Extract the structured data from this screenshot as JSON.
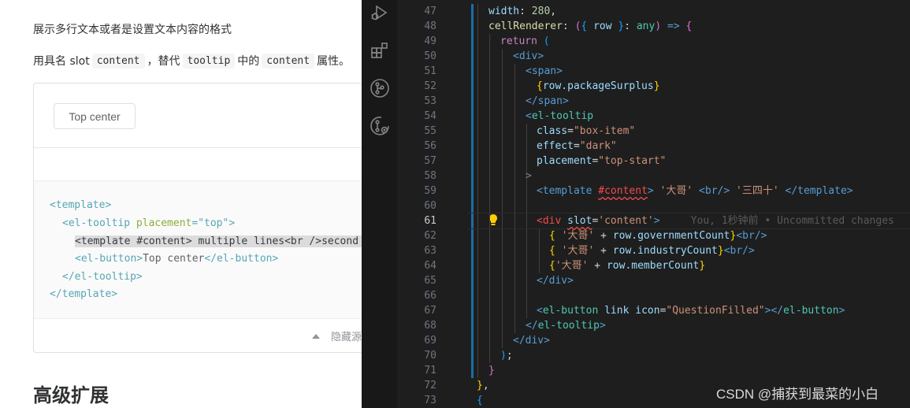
{
  "doc": {
    "paragraph1": "展示多行文本或者是设置文本内容的格式",
    "paragraph2": {
      "part1": "用具名 slot ",
      "code1": "content",
      "part2": "，替代 ",
      "code2": "tooltip",
      "part3": " 中的 ",
      "code3": "content",
      "part4": " 属性。"
    },
    "demo_button_label": "Top center",
    "code_lines": [
      [
        "<template>"
      ],
      [
        "<el-tooltip ",
        "placement",
        "=\"top\">"
      ],
      [
        "<template #content> multiple lines<br />second l"
      ],
      [
        "<el-button>",
        "Top center",
        "</el-button>"
      ],
      [
        "</el-tooltip>"
      ],
      [
        "</template>"
      ]
    ],
    "hide_source_label": "隐藏源",
    "section_heading": "高级扩展"
  },
  "editor": {
    "line_numbers": [
      "47",
      "48",
      "49",
      "50",
      "51",
      "52",
      "53",
      "54",
      "55",
      "56",
      "57",
      "58",
      "59",
      "60",
      "61",
      "62",
      "63",
      "64",
      "65",
      "66",
      "67",
      "68",
      "69",
      "70",
      "71",
      "72",
      "73"
    ],
    "active_line": "61",
    "blame_text": "You, 1秒钟前 • Uncommitted changes",
    "tokens": {
      "width": "width",
      "width_val": "280",
      "cellRenderer": "cellRenderer",
      "row": "row",
      "any": "any",
      "return": "return",
      "div": "div",
      "span": "span",
      "packageSurplus": "row.packageSurplus",
      "el_tooltip": "el-tooltip",
      "class_attr": "class",
      "class_val": "\"box-item\"",
      "effect_attr": "effect",
      "effect_val": "\"dark\"",
      "placement_attr": "placement",
      "placement_val": "\"top-start\"",
      "template": "template",
      "content_slot": "#content",
      "dage": "'大哥'",
      "br": "br",
      "sansishi": "'三四十'",
      "slot_attr": "slot",
      "slot_val": "'content'",
      "governmentCount": "row.governmentCount",
      "industryCount": "row.industryCount",
      "memberCount": "row.memberCount",
      "el_button": "el-button",
      "link_attr": "link",
      "icon_attr": "icon",
      "icon_val": "\"QuestionFilled\""
    }
  },
  "watermark": "CSDN @捕获到最菜的小白",
  "colors": {
    "editor_bg": "#1e1e1e",
    "activity_bg": "#181818",
    "doc_code_tag": "#56a6b3",
    "accent_modified": "#1b6ea8"
  },
  "icons": [
    "run-debug-icon",
    "extensions-icon",
    "source-control-icon",
    "remote-explorer-icon",
    "lightbulb-icon",
    "caret-up-icon"
  ]
}
